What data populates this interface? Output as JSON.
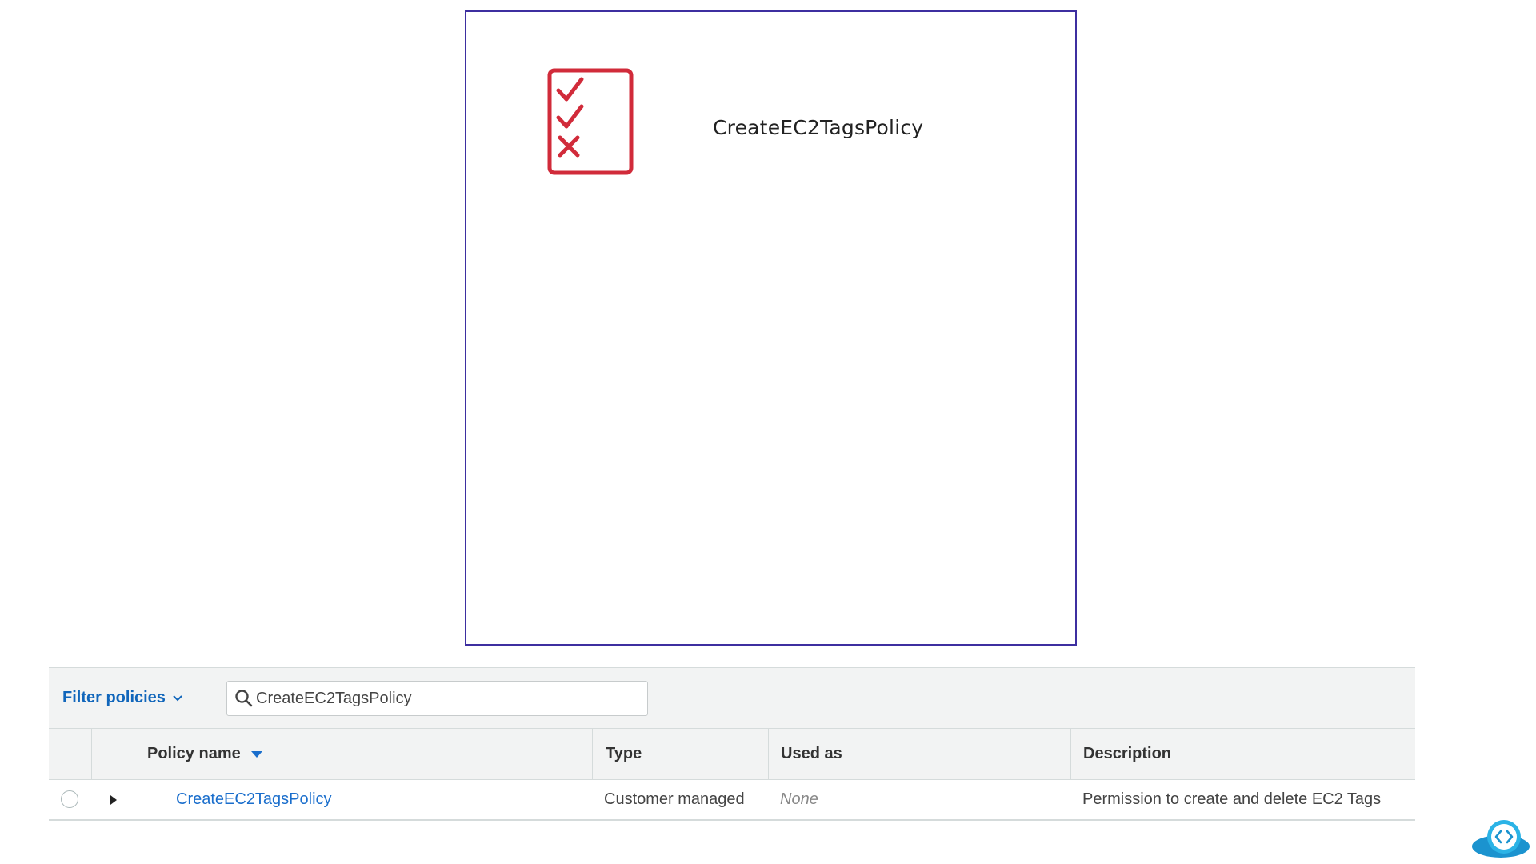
{
  "diagram": {
    "title": "CreateEC2TagsPolicy",
    "icon": "policy-checklist-icon",
    "icon_color": "#d12b3a",
    "frame_color": "#3d2fa0"
  },
  "filter": {
    "label": "Filter policies",
    "search_value": "CreateEC2TagsPolicy"
  },
  "table": {
    "columns": [
      "Policy name",
      "Type",
      "Used as",
      "Description"
    ],
    "sorted_column": "Policy name",
    "rows": [
      {
        "name": "CreateEC2TagsPolicy",
        "type": "Customer managed",
        "used_as": "None",
        "description": "Permission to create and delete EC2 Tags"
      }
    ]
  },
  "brand": {
    "icon": "cloud-code-icon",
    "color": "#1fa3d9"
  }
}
